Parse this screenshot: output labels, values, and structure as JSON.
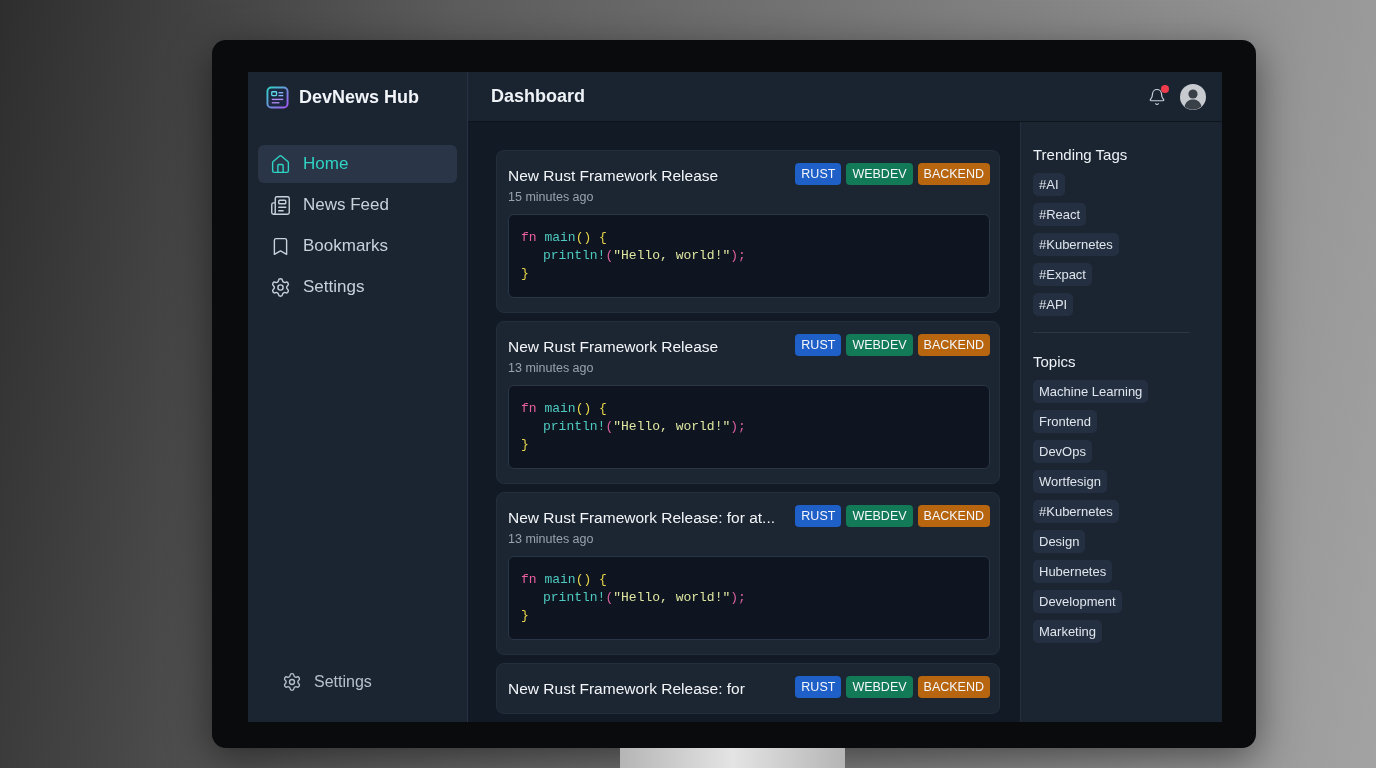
{
  "sidebar": {
    "brand": "DevNews Hub",
    "nav": [
      {
        "label": "Home",
        "selected": true
      },
      {
        "label": "News Feed",
        "selected": false
      },
      {
        "label": "Bookmarks",
        "selected": false
      },
      {
        "label": "Settings",
        "selected": false
      }
    ],
    "footer_link": {
      "label": "Settings"
    }
  },
  "header": {
    "title": "Dashboard",
    "notifications": {
      "unread": true
    }
  },
  "feed": {
    "cards": [
      {
        "title": "New Rust Framework Release",
        "time": "15 minutes ago",
        "tags": [
          {
            "label": "RUST",
            "color": "#1f5fc8"
          },
          {
            "label": "WEBDEV",
            "color": "#137a57"
          },
          {
            "label": "BACKEND",
            "color": "#b8650f"
          }
        ],
        "code": [
          {
            "indented": false,
            "tokens": [
              {
                "text": "fn ",
                "kind": "keyword"
              },
              {
                "text": "main",
                "kind": "function"
              },
              {
                "text": "() {",
                "kind": "punct"
              }
            ]
          },
          {
            "indented": true,
            "tokens": [
              {
                "text": "println!",
                "kind": "macro"
              },
              {
                "text": "(",
                "kind": "paren"
              },
              {
                "text": "\"Hello, world!\"",
                "kind": "string"
              },
              {
                "text": ");",
                "kind": "paren"
              }
            ]
          },
          {
            "indented": false,
            "tokens": [
              {
                "text": "}",
                "kind": "punct"
              }
            ]
          }
        ]
      },
      {
        "title": "New Rust Framework Release",
        "time": "13 minutes ago",
        "tags": [
          {
            "label": "RUST",
            "color": "#1f5fc8"
          },
          {
            "label": "WEBDEV",
            "color": "#137a57"
          },
          {
            "label": "BACKEND",
            "color": "#b8650f"
          }
        ],
        "code": [
          {
            "indented": false,
            "tokens": [
              {
                "text": "fn ",
                "kind": "keyword"
              },
              {
                "text": "main",
                "kind": "function"
              },
              {
                "text": "() {",
                "kind": "punct"
              }
            ]
          },
          {
            "indented": true,
            "tokens": [
              {
                "text": "println!",
                "kind": "macro"
              },
              {
                "text": "(",
                "kind": "paren"
              },
              {
                "text": "\"Hello, world!\"",
                "kind": "string"
              },
              {
                "text": ");",
                "kind": "paren"
              }
            ]
          },
          {
            "indented": false,
            "tokens": [
              {
                "text": "}",
                "kind": "punct"
              }
            ]
          }
        ]
      },
      {
        "title": "New Rust Framework Release: for at...",
        "time": "13 minutes ago",
        "tags": [
          {
            "label": "RUST",
            "color": "#1f5fc8"
          },
          {
            "label": "WEBDEV",
            "color": "#137a57"
          },
          {
            "label": "BACKEND",
            "color": "#b8650f"
          }
        ],
        "code": [
          {
            "indented": false,
            "tokens": [
              {
                "text": "fn ",
                "kind": "keyword"
              },
              {
                "text": "main",
                "kind": "function"
              },
              {
                "text": "() {",
                "kind": "punct"
              }
            ]
          },
          {
            "indented": true,
            "tokens": [
              {
                "text": "println!",
                "kind": "macro"
              },
              {
                "text": "(",
                "kind": "paren"
              },
              {
                "text": "\"Hello, world!\"",
                "kind": "string"
              },
              {
                "text": ");",
                "kind": "paren"
              }
            ]
          },
          {
            "indented": false,
            "tokens": [
              {
                "text": "}",
                "kind": "punct"
              }
            ]
          }
        ]
      },
      {
        "title": "New Rust Framework Release: for",
        "tags": [
          {
            "label": "RUST",
            "color": "#1f5fc8"
          },
          {
            "label": "WEBDEV",
            "color": "#137a57"
          },
          {
            "label": "BACKEND",
            "color": "#b8650f"
          }
        ]
      }
    ]
  },
  "right_panel": {
    "trending_tags": {
      "title": "Trending Tags",
      "items": [
        "#AI",
        "#React",
        "#Kubernetes",
        "#Expact",
        "#API"
      ]
    },
    "topics": {
      "title": "Topics",
      "items": [
        "Machine Learning",
        "Frontend",
        "DevOps",
        "Wortfesign",
        "#Kubernetes",
        "Design",
        "Hubernetes",
        "Development",
        "Marketing"
      ]
    }
  }
}
